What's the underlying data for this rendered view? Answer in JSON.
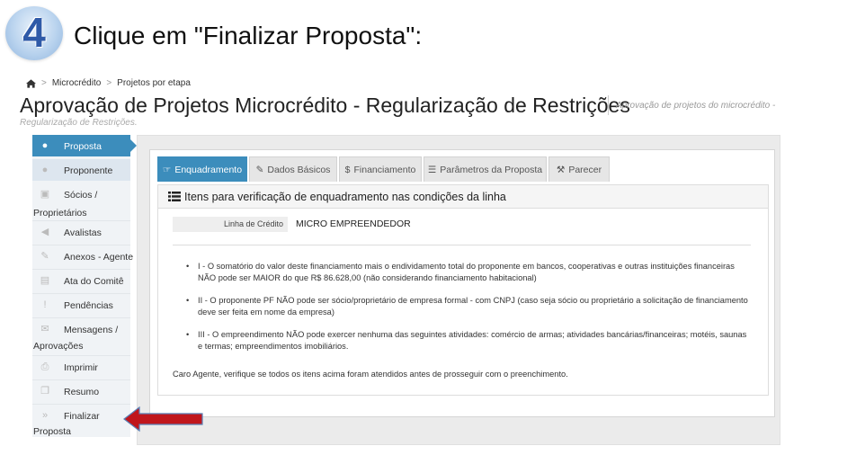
{
  "step": {
    "number": "4",
    "instruction": "Clique em \"Finalizar Proposta\":"
  },
  "breadcrumb": {
    "items": [
      "Microcrédito",
      "Projetos por etapa"
    ]
  },
  "page": {
    "title": "Aprovação de Projetos Microcrédito - Regularização de Restrições",
    "subtitle_line1": "Aprovação de projetos do microcrédito -",
    "subtitle_line2": "Regularização de Restrições."
  },
  "sidebar": {
    "items": [
      {
        "label": "Proposta",
        "icon": "user-icon",
        "active": true
      },
      {
        "label": "Proponente",
        "icon": "users-icon"
      },
      {
        "label": "Sócios /",
        "label2": "Proprietários",
        "icon": "lock-icon"
      },
      {
        "label": "Avalistas",
        "icon": "volume-icon"
      },
      {
        "label": "Anexos - Agente",
        "icon": "paperclip-icon"
      },
      {
        "label": "Ata do Comitê",
        "icon": "file-icon"
      },
      {
        "label": "Pendências",
        "icon": "exclamation-icon"
      },
      {
        "label": "Mensagens /",
        "label2": "Aprovações",
        "icon": "envelope-icon"
      },
      {
        "label": "Imprimir",
        "icon": "print-icon"
      },
      {
        "label": "Resumo",
        "icon": "copy-icon"
      },
      {
        "label": "Finalizar",
        "label2": "Proposta",
        "icon": "forward-icon"
      }
    ]
  },
  "tabs": [
    {
      "label": "Enquadramento",
      "icon": "thumbs-up-icon",
      "glyph": "☞",
      "active": true
    },
    {
      "label": "Dados Básicos",
      "icon": "pencil-icon",
      "glyph": "✎"
    },
    {
      "label": "Financiamento",
      "icon": "dollar-icon",
      "glyph": "$"
    },
    {
      "label": "Parâmetros da Proposta",
      "icon": "list-icon",
      "glyph": "☰"
    },
    {
      "label": "Parecer",
      "icon": "gavel-icon",
      "glyph": "⚒"
    }
  ],
  "panel": {
    "title": "Itens para verificação de enquadramento nas condições da linha",
    "field_label": "Linha de Crédito",
    "field_value": "MICRO EMPREENDEDOR",
    "criteria": [
      "I - O somatório do valor deste financiamento mais o endividamento total do proponente em bancos, cooperativas e outras instituições financeiras NÃO pode ser MAIOR do que R$ 86.628,00 (não considerando financiamento habitacional)",
      "II - O proponente PF NÃO pode ser sócio/proprietário de empresa formal - com CNPJ (caso seja sócio ou proprietário a solicitação de financiamento deve ser feita em nome da empresa)",
      "III - O empreendimento NÃO pode exercer nenhuma das seguintes atividades: comércio de armas; atividades bancárias/financeiras; motéis, saunas e termas; empreendimentos imobiliários."
    ],
    "bullet": "•",
    "note": "Caro Agente, verifique se todos os itens acima foram atendidos antes de prosseguir com o preenchimento."
  },
  "colors": {
    "accent": "#3c8dbc",
    "arrow": "#c0161c",
    "sidebar_bg": "#f0f3f6"
  }
}
